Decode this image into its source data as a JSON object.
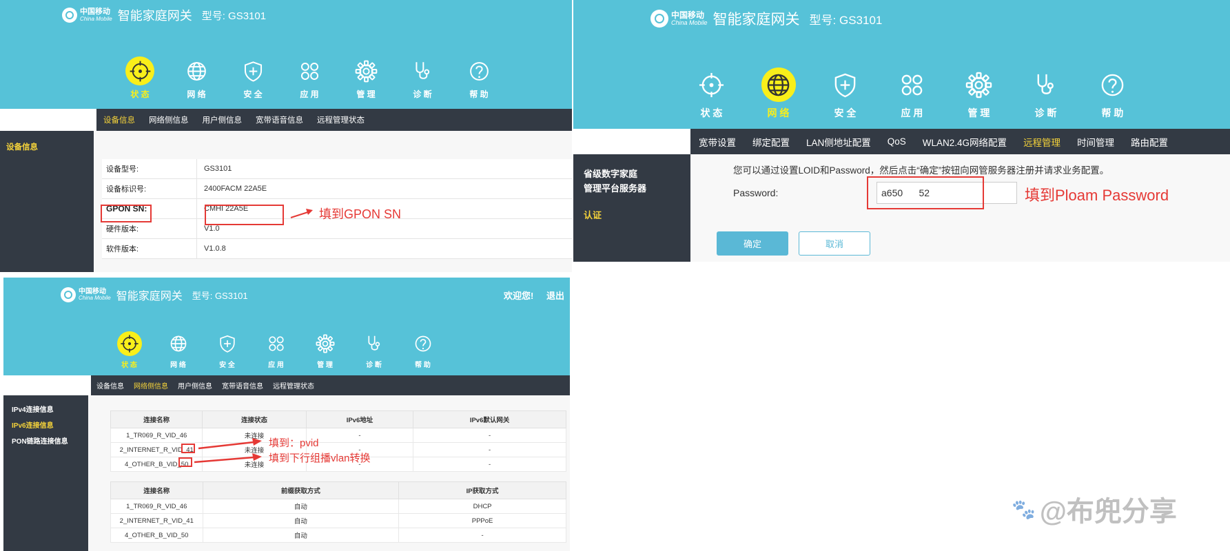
{
  "common": {
    "brand_cn": "中国移动",
    "brand_en": "China Mobile",
    "gateway": "智能家庭网关",
    "model": "型号: GS3101",
    "nav": [
      {
        "label": "状 态",
        "icon": "crosshair-icon"
      },
      {
        "label": "网 络",
        "icon": "globe-icon"
      },
      {
        "label": "安 全",
        "icon": "shield-icon"
      },
      {
        "label": "应 用",
        "icon": "apps-icon"
      },
      {
        "label": "管 理",
        "icon": "gear-icon"
      },
      {
        "label": "诊 断",
        "icon": "stethoscope-icon"
      },
      {
        "label": "帮 助",
        "icon": "help-icon"
      }
    ],
    "colors": {
      "header": "#56c2d8",
      "active_nav": "#f9ef1a",
      "dark_bar": "#333a44",
      "annotation": "#e53935"
    }
  },
  "panel1": {
    "subnav": [
      "设备信息",
      "网络侧信息",
      "用户侧信息",
      "宽带语音信息",
      "远程管理状态"
    ],
    "sidebar": [
      "设备信息"
    ],
    "rows": [
      {
        "label": "设备型号:",
        "value": "GS3101"
      },
      {
        "label": "设备标识号:",
        "value": "2400FACM      22A5E"
      },
      {
        "label": "GPON SN:",
        "value": "CMHI      22A5E"
      },
      {
        "label": "硬件版本:",
        "value": "V1.0"
      },
      {
        "label": "软件版本:",
        "value": "V1.0.8"
      }
    ],
    "annotation": "填到GPON SN"
  },
  "panel2": {
    "subnav": [
      "宽带设置",
      "绑定配置",
      "LAN侧地址配置",
      "QoS",
      "WLAN2.4G网络配置",
      "远程管理",
      "时间管理",
      "路由配置"
    ],
    "sidebar": [
      "省级数字家庭",
      "管理平台服务器",
      "认证"
    ],
    "info": "您可以通过设置LOID和Password，然后点击“确定”按钮向网管服务器注册并请求业务配置。",
    "password_label": "Password:",
    "password_value": "a650      52",
    "confirm": "确定",
    "cancel": "取消",
    "annotation": "填到Ploam Password"
  },
  "panel3": {
    "welcome": "欢迎您!",
    "logout": "退出",
    "subnav": [
      "设备信息",
      "网络侧信息",
      "用户侧信息",
      "宽带语音信息",
      "远程管理状态"
    ],
    "sidebar": [
      "IPv4连接信息",
      "IPv6连接信息",
      "PON链路连接信息"
    ],
    "table1": {
      "headers": [
        "连接名称",
        "连接状态",
        "IPv6地址",
        "IPv6默认网关"
      ],
      "rows": [
        [
          "1_TR069_R_VID_46",
          "未连接",
          "-",
          "-"
        ],
        [
          "2_INTERNET_R_VID_41",
          "未连接",
          "-",
          "-"
        ],
        [
          "4_OTHER_B_VID_50",
          "未连接",
          "-",
          "-"
        ]
      ]
    },
    "table2": {
      "headers": [
        "连接名称",
        "前缀获取方式",
        "IP获取方式"
      ],
      "rows": [
        [
          "1_TR069_R_VID_46",
          "自动",
          "DHCP"
        ],
        [
          "2_INTERNET_R_VID_41",
          "自动",
          "PPPoE"
        ],
        [
          "4_OTHER_B_VID_50",
          "自动",
          "-"
        ]
      ]
    },
    "annotation_pvid": "填到：pvid",
    "annotation_vlan": "填到下行组播vlan转换"
  },
  "watermark": "@布兜分享"
}
